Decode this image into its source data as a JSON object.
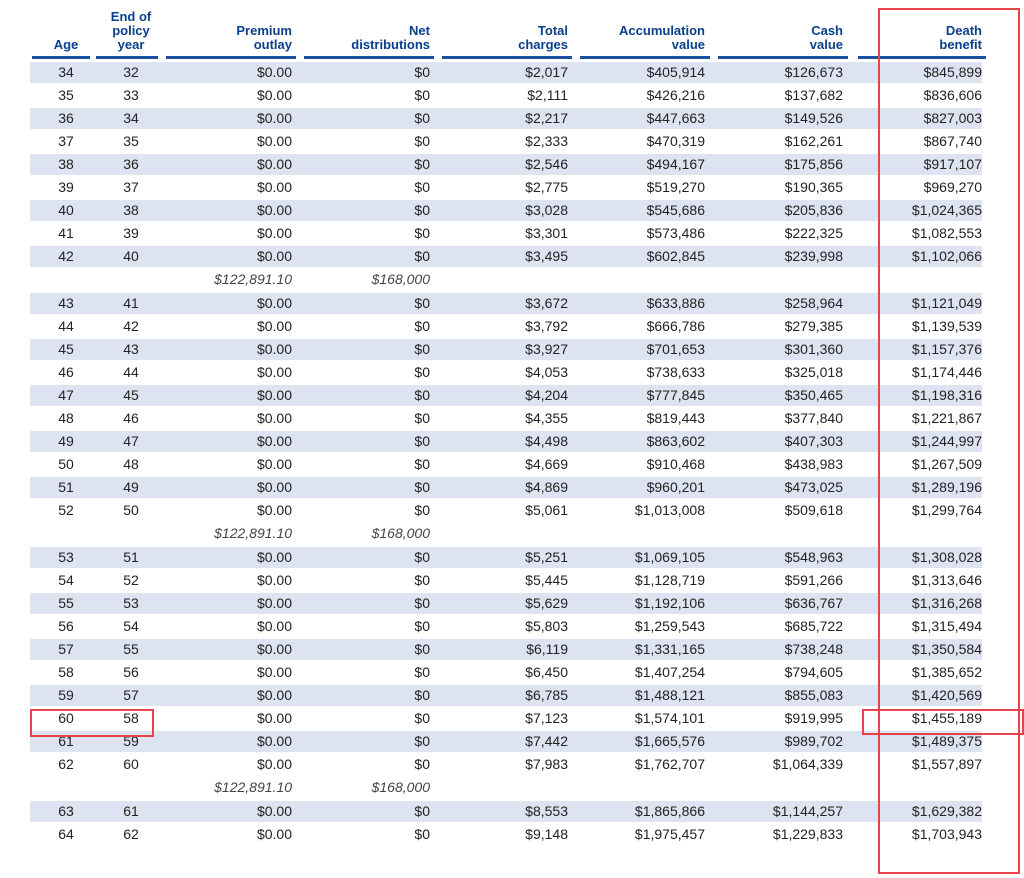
{
  "columns": {
    "age": "Age",
    "policy_year": "End of\npolicy\nyear",
    "premium": "Premium\noutlay",
    "net_dist": "Net\ndistributions",
    "charges": "Total\ncharges",
    "accum": "Accumulation\nvalue",
    "cash": "Cash\nvalue",
    "death": "Death\nbenefit"
  },
  "rows": [
    {
      "age": "34",
      "year": "32",
      "premium": "$0.00",
      "net": "$0",
      "charges": "$2,017",
      "accum": "$405,914",
      "cash": "$126,673",
      "death": "$845,899"
    },
    {
      "age": "35",
      "year": "33",
      "premium": "$0.00",
      "net": "$0",
      "charges": "$2,111",
      "accum": "$426,216",
      "cash": "$137,682",
      "death": "$836,606"
    },
    {
      "age": "36",
      "year": "34",
      "premium": "$0.00",
      "net": "$0",
      "charges": "$2,217",
      "accum": "$447,663",
      "cash": "$149,526",
      "death": "$827,003"
    },
    {
      "age": "37",
      "year": "35",
      "premium": "$0.00",
      "net": "$0",
      "charges": "$2,333",
      "accum": "$470,319",
      "cash": "$162,261",
      "death": "$867,740"
    },
    {
      "age": "38",
      "year": "36",
      "premium": "$0.00",
      "net": "$0",
      "charges": "$2,546",
      "accum": "$494,167",
      "cash": "$175,856",
      "death": "$917,107"
    },
    {
      "age": "39",
      "year": "37",
      "premium": "$0.00",
      "net": "$0",
      "charges": "$2,775",
      "accum": "$519,270",
      "cash": "$190,365",
      "death": "$969,270"
    },
    {
      "age": "40",
      "year": "38",
      "premium": "$0.00",
      "net": "$0",
      "charges": "$3,028",
      "accum": "$545,686",
      "cash": "$205,836",
      "death": "$1,024,365"
    },
    {
      "age": "41",
      "year": "39",
      "premium": "$0.00",
      "net": "$0",
      "charges": "$3,301",
      "accum": "$573,486",
      "cash": "$222,325",
      "death": "$1,082,553"
    },
    {
      "age": "42",
      "year": "40",
      "premium": "$0.00",
      "net": "$0",
      "charges": "$3,495",
      "accum": "$602,845",
      "cash": "$239,998",
      "death": "$1,102,066"
    },
    {
      "subtotal": true,
      "premium": "$122,891.10",
      "net": "$168,000"
    },
    {
      "age": "43",
      "year": "41",
      "premium": "$0.00",
      "net": "$0",
      "charges": "$3,672",
      "accum": "$633,886",
      "cash": "$258,964",
      "death": "$1,121,049"
    },
    {
      "age": "44",
      "year": "42",
      "premium": "$0.00",
      "net": "$0",
      "charges": "$3,792",
      "accum": "$666,786",
      "cash": "$279,385",
      "death": "$1,139,539"
    },
    {
      "age": "45",
      "year": "43",
      "premium": "$0.00",
      "net": "$0",
      "charges": "$3,927",
      "accum": "$701,653",
      "cash": "$301,360",
      "death": "$1,157,376"
    },
    {
      "age": "46",
      "year": "44",
      "premium": "$0.00",
      "net": "$0",
      "charges": "$4,053",
      "accum": "$738,633",
      "cash": "$325,018",
      "death": "$1,174,446"
    },
    {
      "age": "47",
      "year": "45",
      "premium": "$0.00",
      "net": "$0",
      "charges": "$4,204",
      "accum": "$777,845",
      "cash": "$350,465",
      "death": "$1,198,316"
    },
    {
      "age": "48",
      "year": "46",
      "premium": "$0.00",
      "net": "$0",
      "charges": "$4,355",
      "accum": "$819,443",
      "cash": "$377,840",
      "death": "$1,221,867"
    },
    {
      "age": "49",
      "year": "47",
      "premium": "$0.00",
      "net": "$0",
      "charges": "$4,498",
      "accum": "$863,602",
      "cash": "$407,303",
      "death": "$1,244,997"
    },
    {
      "age": "50",
      "year": "48",
      "premium": "$0.00",
      "net": "$0",
      "charges": "$4,669",
      "accum": "$910,468",
      "cash": "$438,983",
      "death": "$1,267,509"
    },
    {
      "age": "51",
      "year": "49",
      "premium": "$0.00",
      "net": "$0",
      "charges": "$4,869",
      "accum": "$960,201",
      "cash": "$473,025",
      "death": "$1,289,196"
    },
    {
      "age": "52",
      "year": "50",
      "premium": "$0.00",
      "net": "$0",
      "charges": "$5,061",
      "accum": "$1,013,008",
      "cash": "$509,618",
      "death": "$1,299,764"
    },
    {
      "subtotal": true,
      "premium": "$122,891.10",
      "net": "$168,000"
    },
    {
      "age": "53",
      "year": "51",
      "premium": "$0.00",
      "net": "$0",
      "charges": "$5,251",
      "accum": "$1,069,105",
      "cash": "$548,963",
      "death": "$1,308,028"
    },
    {
      "age": "54",
      "year": "52",
      "premium": "$0.00",
      "net": "$0",
      "charges": "$5,445",
      "accum": "$1,128,719",
      "cash": "$591,266",
      "death": "$1,313,646"
    },
    {
      "age": "55",
      "year": "53",
      "premium": "$0.00",
      "net": "$0",
      "charges": "$5,629",
      "accum": "$1,192,106",
      "cash": "$636,767",
      "death": "$1,316,268"
    },
    {
      "age": "56",
      "year": "54",
      "premium": "$0.00",
      "net": "$0",
      "charges": "$5,803",
      "accum": "$1,259,543",
      "cash": "$685,722",
      "death": "$1,315,494"
    },
    {
      "age": "57",
      "year": "55",
      "premium": "$0.00",
      "net": "$0",
      "charges": "$6,119",
      "accum": "$1,331,165",
      "cash": "$738,248",
      "death": "$1,350,584"
    },
    {
      "age": "58",
      "year": "56",
      "premium": "$0.00",
      "net": "$0",
      "charges": "$6,450",
      "accum": "$1,407,254",
      "cash": "$794,605",
      "death": "$1,385,652"
    },
    {
      "age": "59",
      "year": "57",
      "premium": "$0.00",
      "net": "$0",
      "charges": "$6,785",
      "accum": "$1,488,121",
      "cash": "$855,083",
      "death": "$1,420,569"
    },
    {
      "age": "60",
      "year": "58",
      "premium": "$0.00",
      "net": "$0",
      "charges": "$7,123",
      "accum": "$1,574,101",
      "cash": "$919,995",
      "death": "$1,455,189",
      "highlight": true
    },
    {
      "age": "61",
      "year": "59",
      "premium": "$0.00",
      "net": "$0",
      "charges": "$7,442",
      "accum": "$1,665,576",
      "cash": "$989,702",
      "death": "$1,489,375"
    },
    {
      "age": "62",
      "year": "60",
      "premium": "$0.00",
      "net": "$0",
      "charges": "$7,983",
      "accum": "$1,762,707",
      "cash": "$1,064,339",
      "death": "$1,557,897"
    },
    {
      "subtotal": true,
      "premium": "$122,891.10",
      "net": "$168,000"
    },
    {
      "age": "63",
      "year": "61",
      "premium": "$0.00",
      "net": "$0",
      "charges": "$8,553",
      "accum": "$1,865,866",
      "cash": "$1,144,257",
      "death": "$1,629,382"
    },
    {
      "age": "64",
      "year": "62",
      "premium": "$0.00",
      "net": "$0",
      "charges": "$9,148",
      "accum": "$1,975,457",
      "cash": "$1,229,833",
      "death": "$1,703,943"
    }
  ],
  "colors": {
    "header": "#0a3f8c",
    "stripe": "#dde3f1",
    "highlight": "#e8434b"
  }
}
